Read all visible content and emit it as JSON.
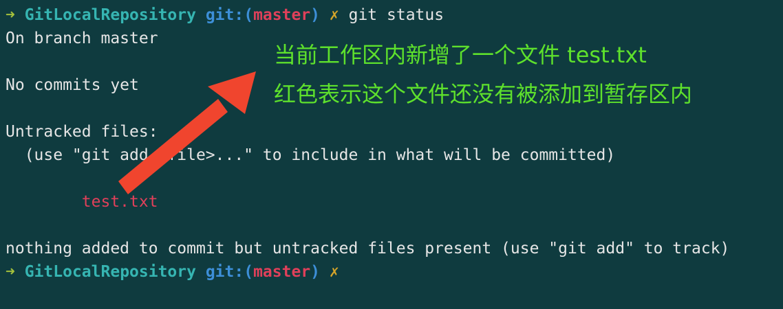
{
  "prompt": {
    "arrow": "➜",
    "directory": "GitLocalRepository",
    "git_prefix": "git:(",
    "branch": "master",
    "git_suffix": ")",
    "dirty_mark": "✗"
  },
  "command": "git status",
  "output": {
    "branch_line": "On branch master",
    "commits_line": "No commits yet",
    "untracked_header": "Untracked files:",
    "hint_line": "  (use \"git add <file>...\" to include in what will be committed)",
    "untracked_file": "        test.txt",
    "summary_line": "nothing added to commit but untracked files present (use \"git add\" to track)"
  },
  "annotations": {
    "line1": "当前工作区内新增了一个文件 test.txt",
    "line2": "红色表示这个文件还没有被添加到暂存区内"
  },
  "colors": {
    "background": "#0f3b3f",
    "annotation_text": "#5ee12c",
    "pointer_arrow": "#f0452e",
    "untracked": "#e0405a"
  }
}
